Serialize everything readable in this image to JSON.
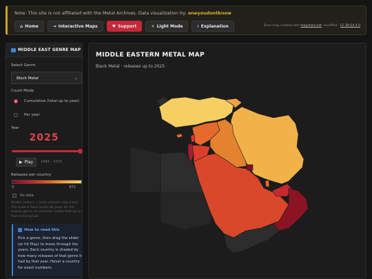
{
  "banner": {
    "note": "Note: This site is not affiliated with the Metal Archives. Data visualization by: ",
    "author": "oneyoudontknow",
    "credit_text": "Base map created with ",
    "credit_link": "mapchart.net",
    "credit_mid": ", modified - ",
    "credit_license": "CC BY-SA 4.0"
  },
  "nav": [
    {
      "icon": "home-icon",
      "glyph": "⌂",
      "label": "Home"
    },
    {
      "icon": "arrow-icon",
      "glyph": "→",
      "label": "Interactive Maps"
    },
    {
      "icon": "heart-icon",
      "glyph": "♥",
      "label": "Support"
    },
    {
      "icon": "sun-icon",
      "glyph": "☀",
      "label": "Light Mode"
    },
    {
      "icon": "info-icon",
      "glyph": "ℹ",
      "label": "Explanation"
    }
  ],
  "sidebar": {
    "title": "MIDDLE EAST GENRE MAP",
    "collapse_glyph": "▾",
    "genre_label": "Select Genre",
    "genre_value": "Black Metal",
    "count_mode_label": "Count Mode",
    "mode_cumulative": "Cumulative (total up to year)",
    "mode_per_year": "Per year",
    "year_label": "Year",
    "year_value": "2025",
    "play_label": "Play",
    "range_text": "1984 – 2025",
    "legend_label": "Releases per country",
    "legend_min": "0",
    "legend_max": "872",
    "nodata_label": "No data",
    "note": "Redder colours = more releases (log scale). The scale is fixed across all years for the chosen genre, so countries visibly heat up as their scene grows.",
    "howto_title": "How to read this",
    "howto_text": "Pick a genre, then drag the slider (or hit Play) to move through the years. Each country is shaded by how many releases of that genre it had by that year. Hover a country for exact numbers."
  },
  "main": {
    "title": "MIDDLE EASTERN METAL MAP",
    "subtitle": "Black Metal · releases up to 2025"
  },
  "colors": {
    "accent": "#c4283a",
    "info": "#3d7fd4",
    "banner_accent": "#c9a227"
  }
}
